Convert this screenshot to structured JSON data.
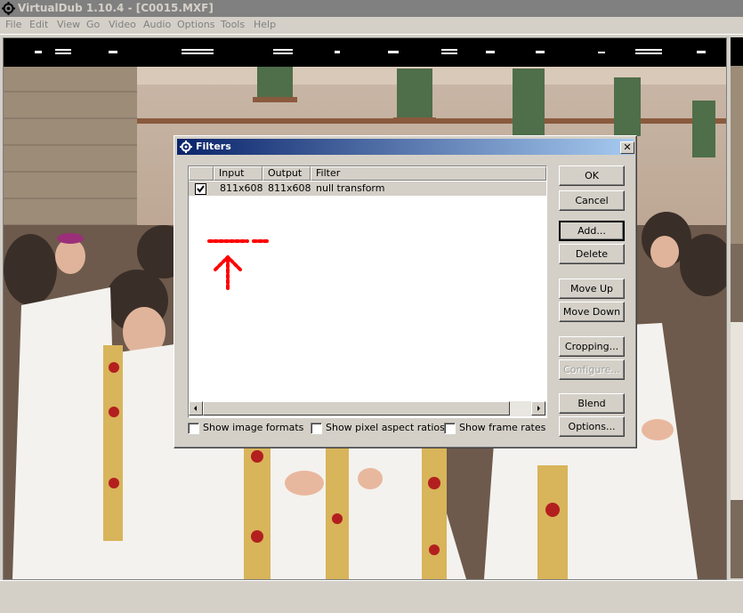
{
  "window": {
    "title": "VirtualDub 1.10.4 - [C0015.MXF]"
  },
  "menu": [
    {
      "label": "File"
    },
    {
      "label": "Edit"
    },
    {
      "label": "View"
    },
    {
      "label": "Go"
    },
    {
      "label": "Video"
    },
    {
      "label": "Audio"
    },
    {
      "label": "Options"
    },
    {
      "label": "Tools"
    },
    {
      "label": "Help"
    }
  ],
  "dialog": {
    "title": "Filters",
    "close_label": "✕",
    "list": {
      "columns": [
        "Input",
        "Output",
        "Filter"
      ],
      "rows": [
        {
          "checked": true,
          "input": "811x608",
          "output": "811x608",
          "filter": "null transform"
        }
      ]
    },
    "buttons": {
      "ok": "OK",
      "cancel": "Cancel",
      "add": "Add...",
      "delete": "Delete",
      "move_up": "Move Up",
      "move_down": "Move Down",
      "cropping": "Cropping...",
      "configure": "Configure...",
      "blend": "Blend",
      "options": "Options..."
    },
    "checkboxes": {
      "show_image_formats": "Show image formats",
      "show_pixel_aspect_ratios": "Show pixel aspect ratios",
      "show_frame_rates": "Show frame rates"
    }
  },
  "colors": {
    "dialog_title_start": "#0a246a",
    "dialog_title_end": "#a6caf0",
    "annotation": "#ff0000"
  }
}
